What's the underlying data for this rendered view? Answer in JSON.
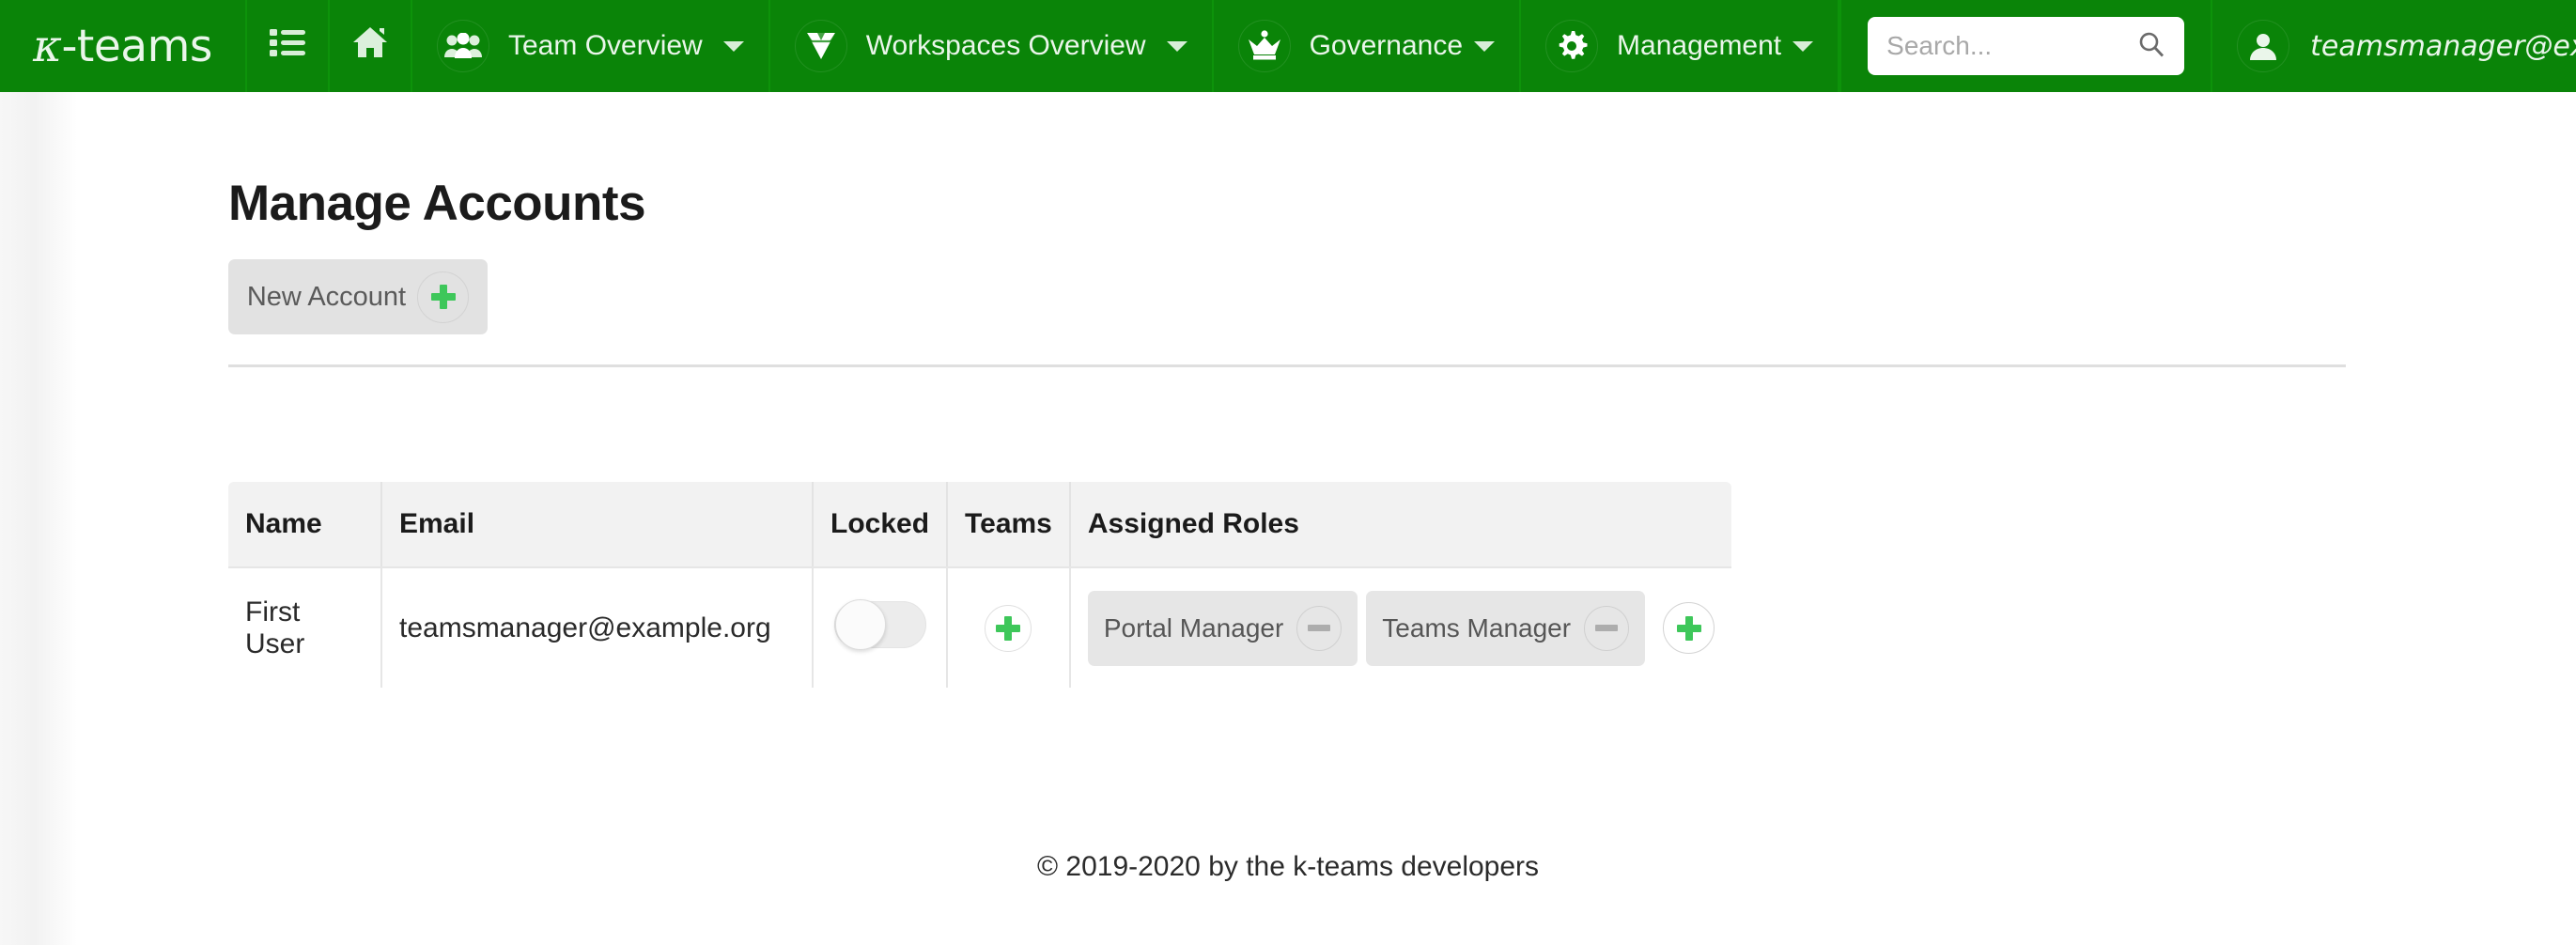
{
  "brand": {
    "prefix": "κ",
    "suffix": "-teams"
  },
  "navbar": {
    "background": "#0a8408",
    "items": [
      {
        "icon": "list-icon",
        "label": "",
        "caret": false
      },
      {
        "icon": "home-icon",
        "label": "",
        "caret": false
      },
      {
        "icon": "users-icon",
        "label": "Team Overview",
        "caret": true
      },
      {
        "icon": "gem-icon",
        "label": "Workspaces Overview",
        "caret": true
      },
      {
        "icon": "crown-icon",
        "label": "Governance",
        "caret": true
      },
      {
        "icon": "gear-icon",
        "label": "Management",
        "caret": true
      }
    ],
    "search": {
      "value": "",
      "placeholder": "Search...",
      "icon": "search-icon"
    },
    "user": {
      "icon": "user-icon",
      "email": "teamsmanager@example.org"
    }
  },
  "main": {
    "title": "Manage Accounts",
    "new_account_button": {
      "label": "New Account",
      "icon": "plus-icon"
    },
    "table": {
      "columns": [
        "Name",
        "Email",
        "Locked",
        "Teams",
        "Assigned Roles"
      ],
      "rows": [
        {
          "name": "First User",
          "email": "teamsmanager@example.org",
          "locked": false,
          "teams_add_icon": "plus-icon",
          "roles": [
            "Portal Manager",
            "Teams Manager"
          ],
          "role_remove_icon": "minus-icon",
          "role_add_icon": "plus-icon"
        }
      ]
    }
  },
  "footer": {
    "text": "© 2019-2020 by the k-teams developers"
  },
  "colors": {
    "brand_green": "#0a8408",
    "accent_green": "#3ec75a",
    "chip_gray": "#e6e6e6",
    "header_gray": "#f2f2f2"
  }
}
